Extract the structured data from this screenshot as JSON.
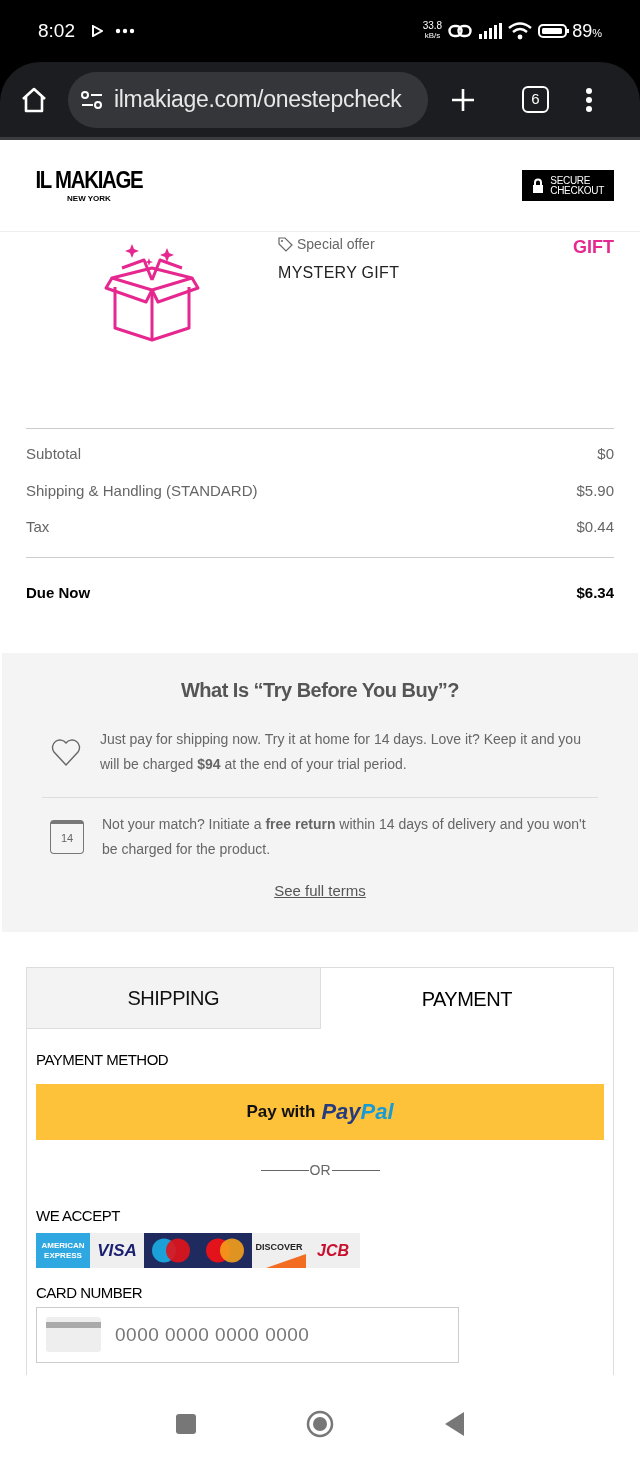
{
  "status_bar": {
    "time": "8:02",
    "speed": "33.8",
    "speed_unit": "kB/s",
    "battery": "89",
    "battery_unit": "%"
  },
  "browser": {
    "url": "ilmakiage.com/onestepcheck",
    "tab_count": "6"
  },
  "header": {
    "brand": "IL MAKIAGE",
    "brand_sub": "NEW YORK",
    "badge": [
      "SECURE",
      "CHECKOUT"
    ]
  },
  "product": {
    "tag": "Special offer",
    "name": "MYSTERY GIFT",
    "price": "GIFT"
  },
  "summary": [
    {
      "label": "Subtotal",
      "value": "$0"
    },
    {
      "label": "Shipping & Handling (STANDARD)",
      "value": "$5.90"
    },
    {
      "label": "Tax",
      "value": "$0.44"
    }
  ],
  "due": {
    "label": "Due Now",
    "value": "$6.34"
  },
  "try_before": {
    "title": "What Is “Try Before You Buy”?",
    "items": [
      {
        "kind": "heart",
        "text": "Just pay for shipping now. Try it at home for 14 days. Love it? Keep it and you will be charged **$94** at the end of your trial period."
      },
      {
        "kind": "calendar",
        "day": "14",
        "text": "Not your match? Initiate a **free return** within 14 days of delivery and you won't be charged for the product."
      }
    ],
    "link": "See full terms"
  },
  "tabs": [
    {
      "label": "SHIPPING",
      "selected": false
    },
    {
      "label": "PAYMENT",
      "selected": true
    }
  ],
  "payment": {
    "method_label": "PAYMENT METHOD",
    "paypal_prefix": "Pay with",
    "paypal_logo": [
      "Pay",
      "Pal"
    ],
    "or": "OR",
    "accept_label": "WE ACCEPT",
    "cards": [
      {
        "kind": "amex",
        "label": [
          "AMERICAN",
          "EXPRESS"
        ]
      },
      {
        "kind": "visa",
        "label": [
          "VISA"
        ]
      },
      {
        "kind": "maestro"
      },
      {
        "kind": "mastercard"
      },
      {
        "kind": "discover",
        "label": [
          "DISCOVER"
        ]
      },
      {
        "kind": "jcb",
        "label": [
          "JCB"
        ]
      }
    ],
    "card_number_label": "CARD NUMBER",
    "card_number_placeholder": "0000 0000 0000 0000"
  }
}
